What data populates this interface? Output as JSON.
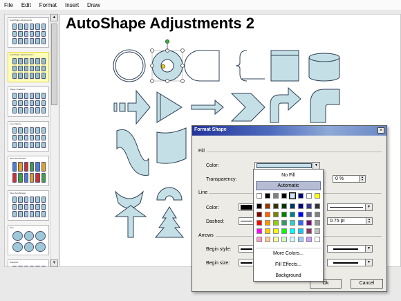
{
  "menubar": {
    "items": [
      "File",
      "Edit",
      "Format",
      "Insert",
      "Draw"
    ]
  },
  "slide_panel": {
    "thumbnails": [
      {
        "title": "AutoShape Adjustments"
      },
      {
        "title": "AutoShape Adjustments 2",
        "selected": true
      },
      {
        "title": "Shape Gradients"
      },
      {
        "title": "Line Options"
      },
      {
        "title": "More AutoShapes"
      },
      {
        "title": "More AutoShapes"
      },
      {
        "title": "Pies"
      },
      {
        "title": "Shadows"
      }
    ]
  },
  "slide": {
    "title": "AutoShape Adjustments 2"
  },
  "dialog": {
    "title": "Format Shape",
    "close": "×",
    "fill_group": "Fill",
    "color_label": "Color:",
    "transparency_label": "Transparency:",
    "transparency_value": "0 %",
    "line_group": "Line",
    "line_color_label": "Color:",
    "dashed_label": "Dashed:",
    "line_width_value": "0.75 pt",
    "arrows_group": "Arrows",
    "begin_style_label": "Begin style:",
    "begin_size_label": "Begin size:",
    "ok": "Ok",
    "cancel": "Cancel"
  },
  "color_popup": {
    "no_fill": "No Fill",
    "automatic": "Automatic",
    "more_colors": "More Colors...",
    "fill_effects": "Fill Effects...",
    "background": "Background",
    "swatches": [
      [
        "#ffffff",
        "#000000",
        "#808080",
        "#000000",
        "#cce6ff",
        "#000080",
        "#ffffff",
        "#ffff00"
      ],
      [
        "#000000",
        "#993300",
        "#333300",
        "#003300",
        "#003366",
        "#000080",
        "#333399",
        "#333333"
      ],
      [
        "#800000",
        "#ff6600",
        "#808000",
        "#008000",
        "#008080",
        "#0000ff",
        "#666699",
        "#808080"
      ],
      [
        "#ff0000",
        "#ff9900",
        "#99cc00",
        "#339966",
        "#33cccc",
        "#3366ff",
        "#800080",
        "#969696"
      ],
      [
        "#ff00ff",
        "#ffcc00",
        "#ffff00",
        "#00ff00",
        "#00ffff",
        "#00ccff",
        "#993366",
        "#c0c0c0"
      ],
      [
        "#ff99cc",
        "#ffcc99",
        "#ffff99",
        "#ccffcc",
        "#ccffff",
        "#99ccff",
        "#cc99ff",
        "#ffffff"
      ]
    ]
  },
  "colors": {
    "shape_fill": "#c4dfe6",
    "shape_stroke": "#2e4057",
    "titlebar": "#23339a"
  }
}
